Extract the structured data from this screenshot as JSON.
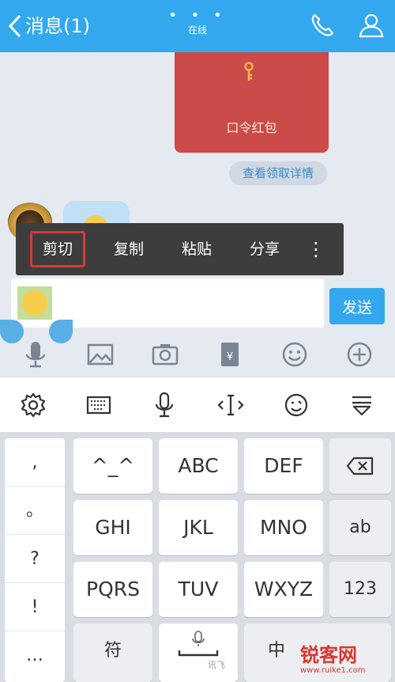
{
  "header": {
    "back_label": "消息(1)",
    "dots": "• • •",
    "status": "在线"
  },
  "chat": {
    "redpacket_label": "口令红包",
    "view_detail": "查看领取详情"
  },
  "context_menu": {
    "items": [
      "剪切",
      "复制",
      "粘贴",
      "分享"
    ],
    "more": "⋮"
  },
  "input": {
    "send_label": "发送"
  },
  "keyboard": {
    "punct": [
      ",",
      "。",
      "?",
      "!",
      "…"
    ],
    "rows": [
      [
        "^_^",
        "ABC",
        "DEF"
      ],
      [
        "GHI",
        "JKL",
        "MNO"
      ],
      [
        "PQRS",
        "TUV",
        "WXYZ"
      ]
    ],
    "fn_keys": {
      "ab": "ab",
      "num": "123",
      "symbol": "符",
      "chinese": "中",
      "voice_brand": "讯飞"
    },
    "watermark": "锐客网",
    "watermark_sub": "www.ruike1.com"
  },
  "colors": {
    "accent": "#33a8ee",
    "redpacket": "#cb4b49",
    "menu_bg": "#3d3d3d",
    "highlight": "#d63a36"
  }
}
